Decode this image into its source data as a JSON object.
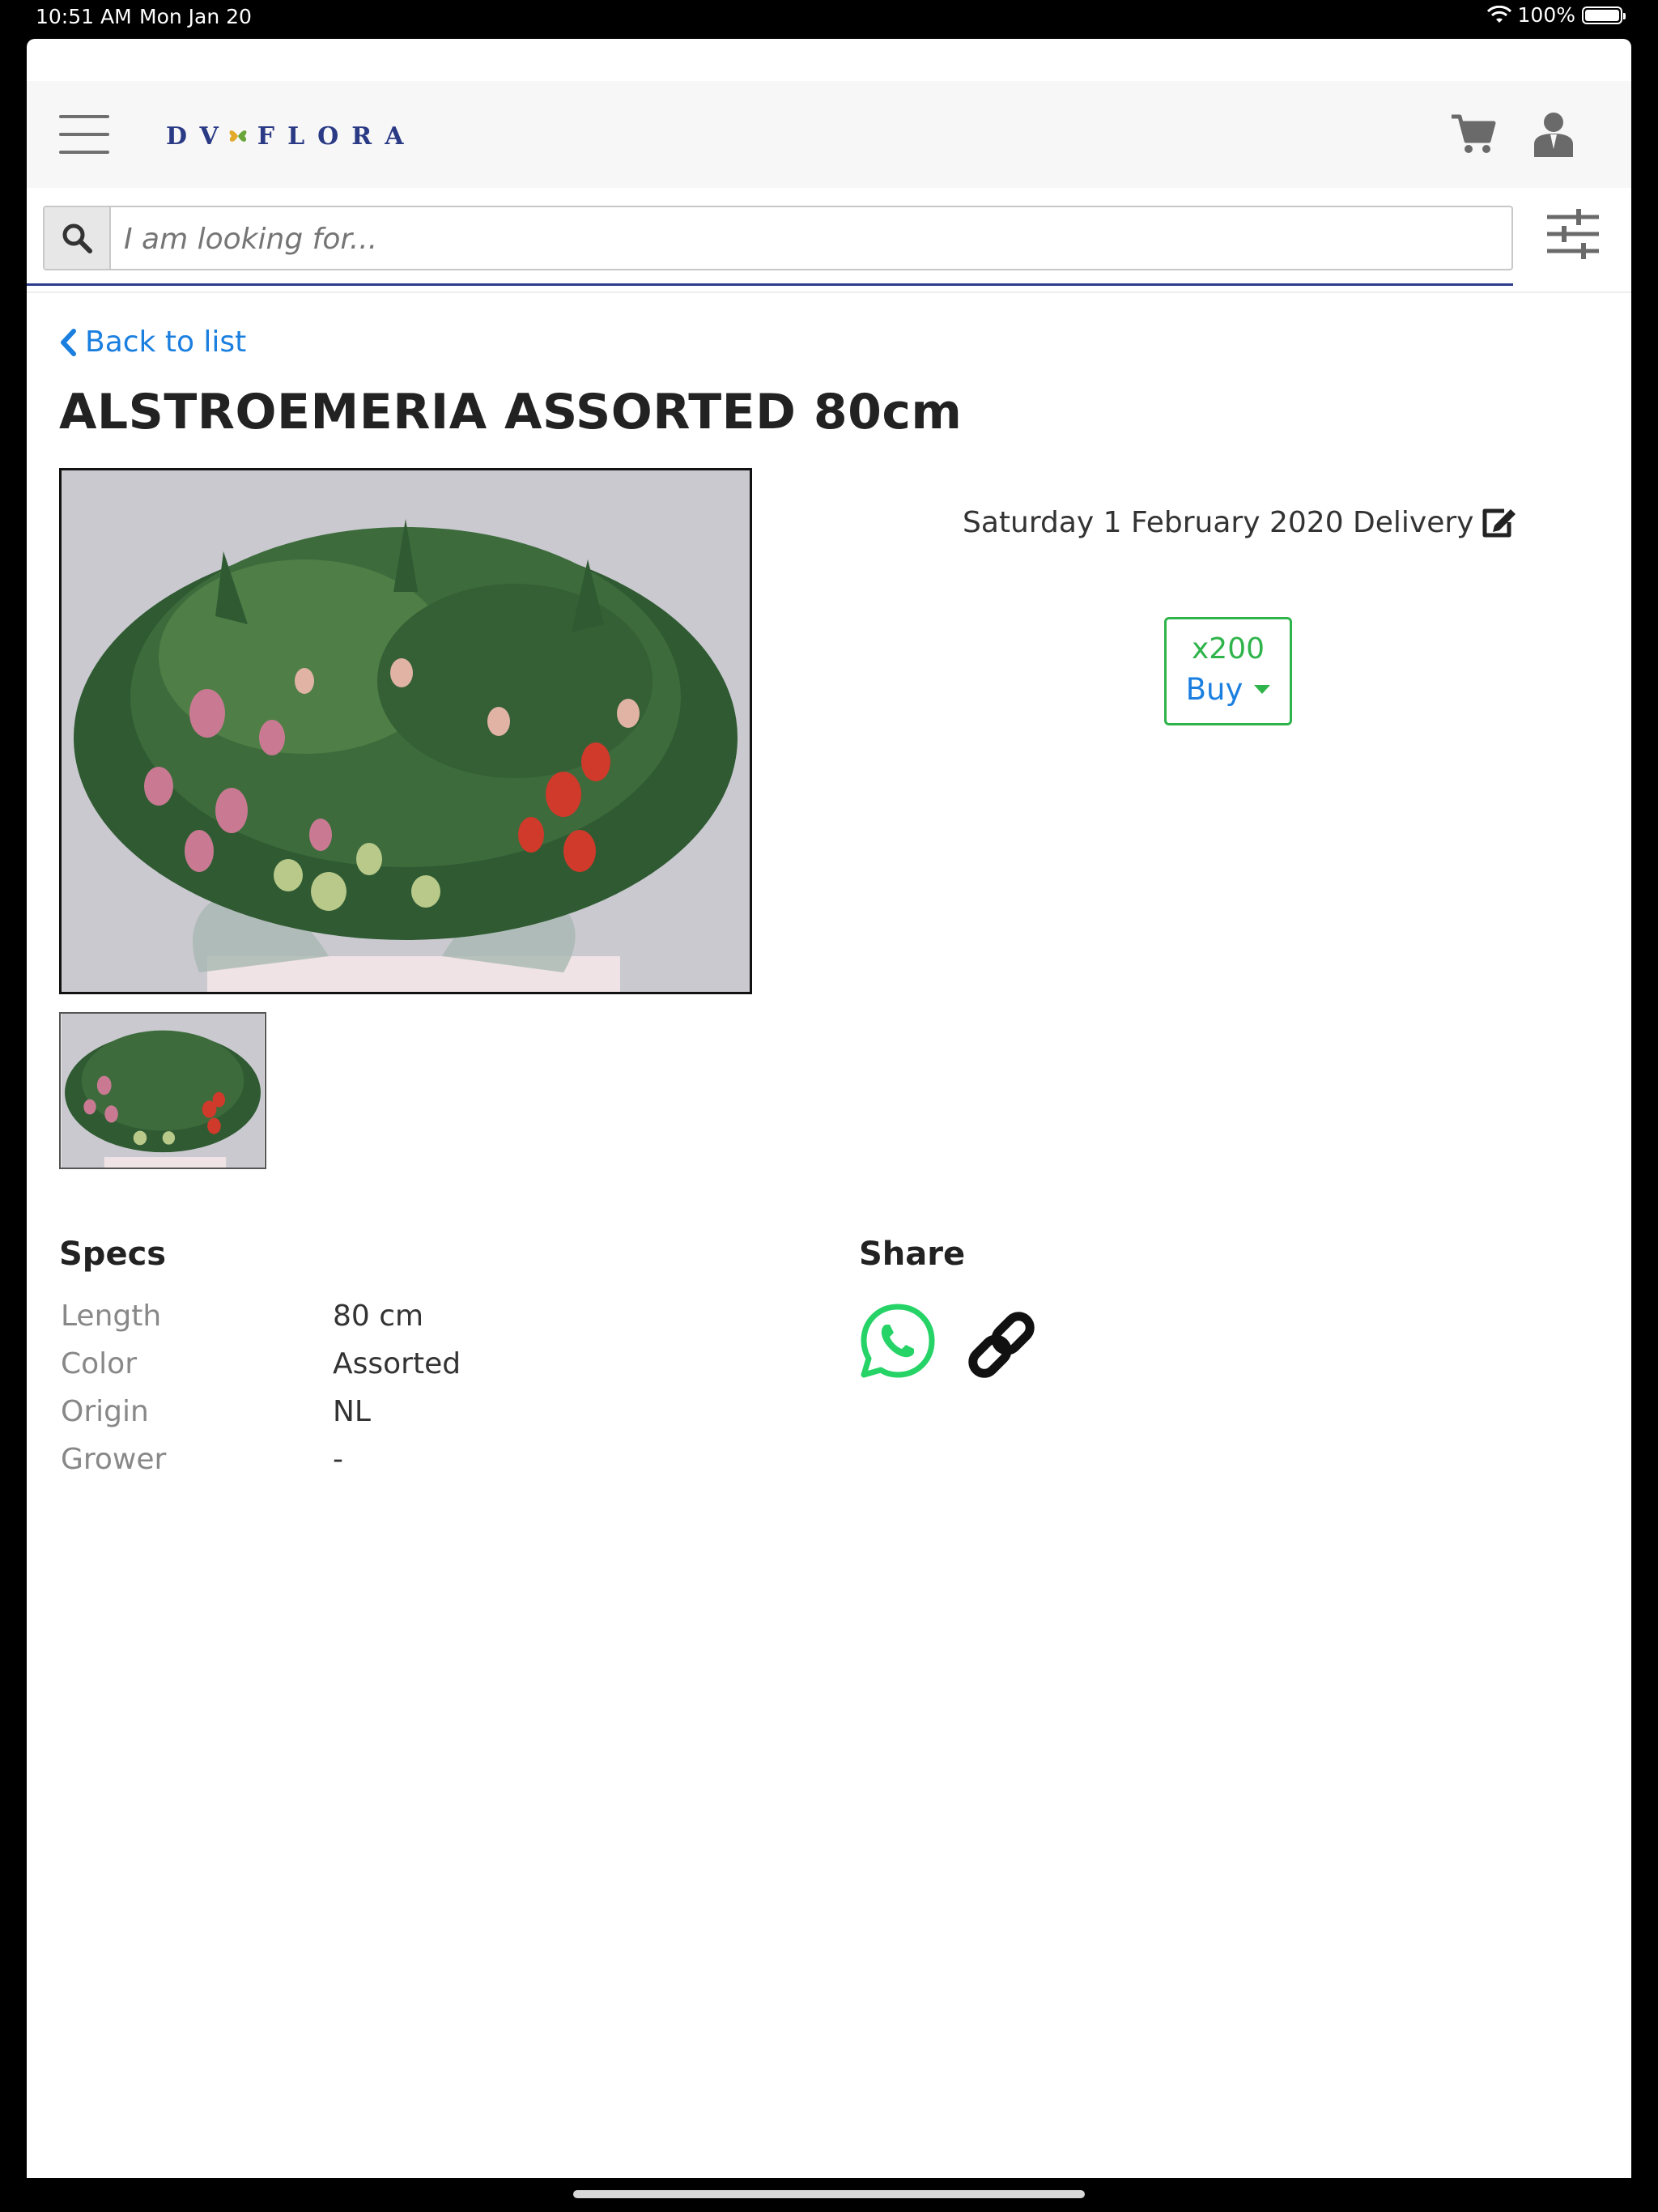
{
  "status_bar": {
    "time": "10:51 AM",
    "date": "Mon Jan 20",
    "battery": "100%"
  },
  "header": {
    "logo_text": "DV FLORA"
  },
  "search": {
    "placeholder": "I am looking for..."
  },
  "back_link": {
    "label": "Back to list"
  },
  "product": {
    "title": "ALSTROEMERIA ASSORTED 80cm",
    "delivery_text": "Saturday 1 February 2020 Delivery",
    "quantity": "x200",
    "buy_label": "Buy"
  },
  "specs": {
    "title": "Specs",
    "rows": [
      {
        "label": "Length",
        "value": "80 cm"
      },
      {
        "label": "Color",
        "value": "Assorted"
      },
      {
        "label": "Origin",
        "value": "NL"
      },
      {
        "label": "Grower",
        "value": "-"
      }
    ]
  },
  "share": {
    "title": "Share"
  },
  "colors": {
    "accent_blue": "#1b7fe0",
    "buy_green": "#2fb44b",
    "whatsapp_green": "#25d366",
    "brand_navy": "#2a3a84"
  },
  "icons": [
    "search-icon",
    "cart-icon",
    "user-icon",
    "filter-icon",
    "chevron-left-icon",
    "edit-icon",
    "caret-down-icon",
    "whatsapp-icon",
    "link-icon",
    "wifi-icon",
    "battery-icon"
  ]
}
